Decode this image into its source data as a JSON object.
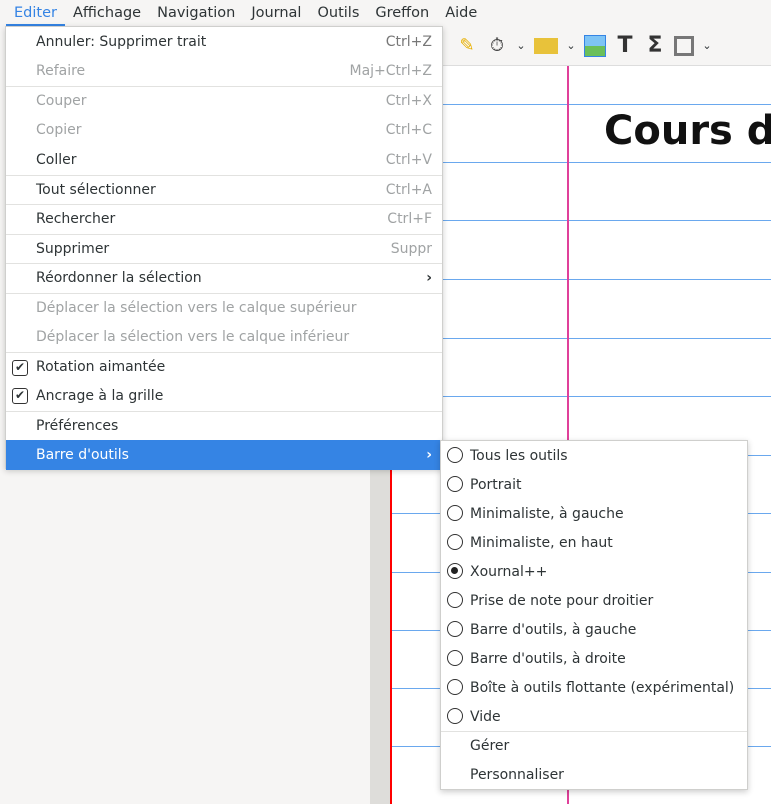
{
  "menubar": [
    "Editer",
    "Affichage",
    "Navigation",
    "Journal",
    "Outils",
    "Greffon",
    "Aide"
  ],
  "page": {
    "title": "Cours de"
  },
  "edit_menu": [
    {
      "label": "Annuler: Supprimer trait",
      "shortcut": "Ctrl+Z"
    },
    {
      "label": "Refaire",
      "shortcut": "Maj+Ctrl+Z"
    },
    {
      "label": "Couper",
      "shortcut": "Ctrl+X"
    },
    {
      "label": "Copier",
      "shortcut": "Ctrl+C"
    },
    {
      "label": "Coller",
      "shortcut": "Ctrl+V"
    },
    {
      "label": "Tout sélectionner",
      "shortcut": "Ctrl+A"
    },
    {
      "label": "Rechercher",
      "shortcut": "Ctrl+F"
    },
    {
      "label": "Supprimer",
      "shortcut": "Suppr"
    },
    {
      "label": "Réordonner la sélection"
    },
    {
      "label": "Déplacer la sélection vers le calque supérieur"
    },
    {
      "label": "Déplacer la sélection vers le calque inférieur"
    },
    {
      "label": "Rotation aimantée"
    },
    {
      "label": "Ancrage à la grille"
    },
    {
      "label": "Préférences"
    },
    {
      "label": "Barre d'outils"
    }
  ],
  "toolbar_submenu": [
    "Tous les outils",
    "Portrait",
    "Minimaliste, à gauche",
    "Minimaliste, en haut",
    "Xournal++",
    "Prise de note pour droitier",
    "Barre d'outils, à gauche",
    "Barre d'outils, à droite",
    "Boîte à outils flottante (expérimental)",
    "Vide",
    "Gérer",
    "Personnaliser"
  ],
  "selected_toolbar": "Xournal++"
}
